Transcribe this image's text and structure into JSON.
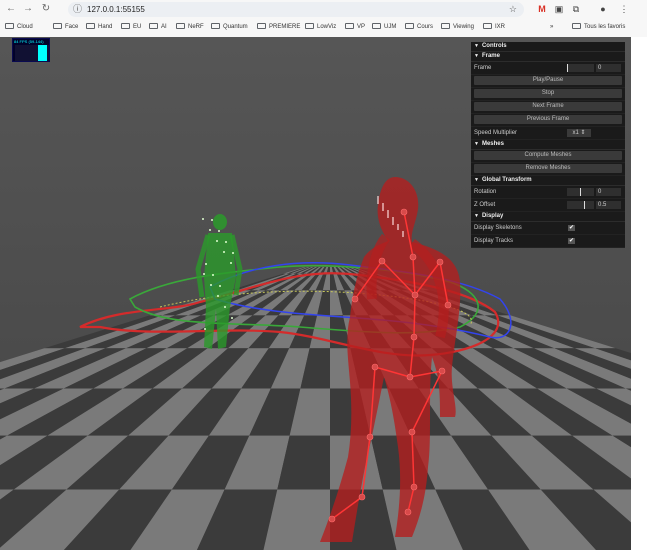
{
  "browser": {
    "url": "127.0.0.1:55155",
    "bookmarks": [
      "Cloud",
      "Face",
      "Hand",
      "EU",
      "AI",
      "NeRF",
      "Quantum",
      "PREMIERE",
      "LowViz",
      "VP",
      "UJM",
      "Cours",
      "Viewing",
      "IXR"
    ],
    "overflow": "»",
    "all_bookmarks": "Tous les favoris"
  },
  "fps": {
    "label": "84 FPS (59-144)"
  },
  "controls": {
    "title": "Controls",
    "frame_section": {
      "title": "Frame",
      "frame_label": "Frame",
      "frame_value": "0",
      "play_pause": "Play/Pause",
      "stop": "Stop",
      "next_frame": "Next Frame",
      "previous_frame": "Previous Frame",
      "speed_label": "Speed Multiplier",
      "speed_value": "x1"
    },
    "meshes_section": {
      "title": "Meshes",
      "compute": "Compute Meshes",
      "remove": "Remove Meshes"
    },
    "global_transform": {
      "title": "Global Transform",
      "rotation_label": "Rotation",
      "rotation_value": "0",
      "zoffset_label": "Z Offset",
      "zoffset_value": "0.5"
    },
    "display": {
      "title": "Display",
      "skeletons_label": "Display Skeletons",
      "skeletons_checked": true,
      "tracks_label": "Display Tracks",
      "tracks_checked": true
    }
  },
  "colors": {
    "red_figure": "#b51e1e",
    "green_figure": "#2a9a2a",
    "track_blue": "#3344ee",
    "floor_light": "#7a7a7a",
    "floor_dark": "#3b3b3b"
  }
}
